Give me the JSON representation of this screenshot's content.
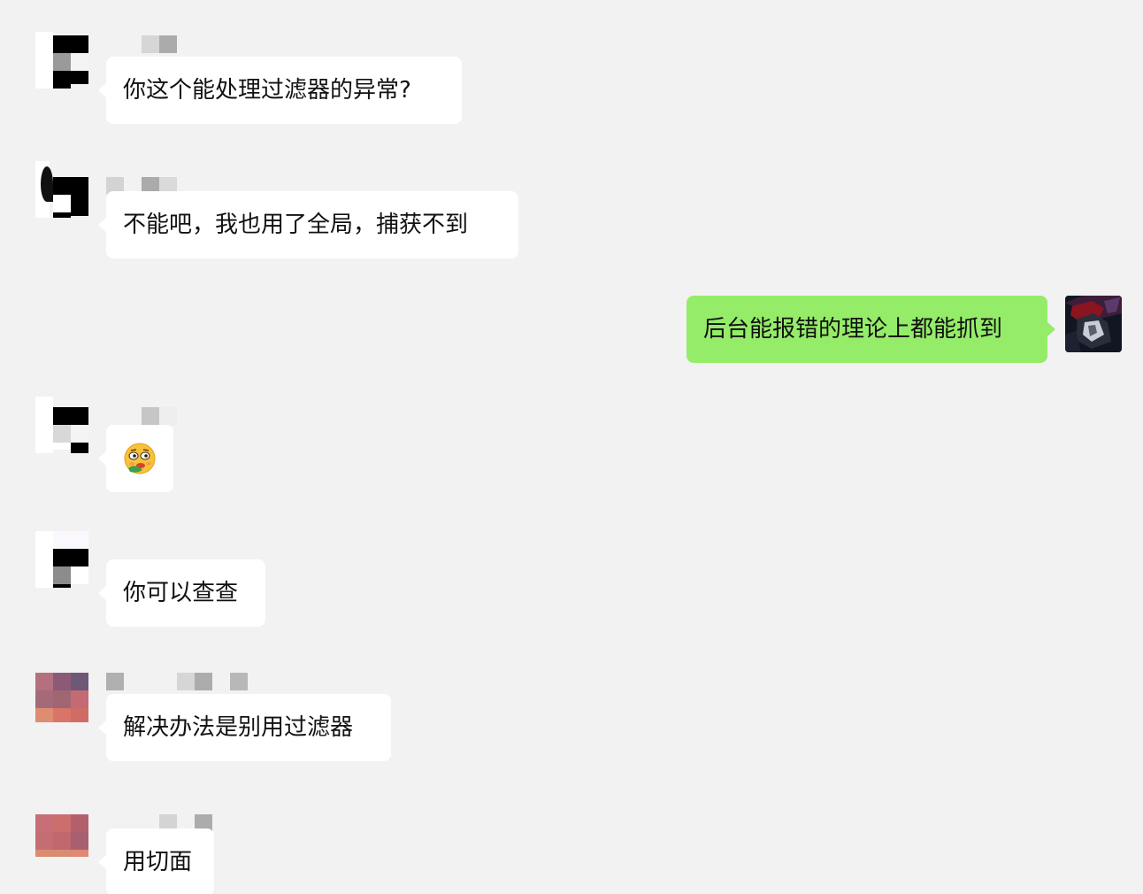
{
  "colors": {
    "background": "#f2f2f2",
    "incoming_bubble": "#ffffff",
    "outgoing_bubble": "#95ec69",
    "text": "#111111"
  },
  "messages": [
    {
      "side": "left",
      "sender_name": "",
      "text": "你这个能处理过滤器的异常?"
    },
    {
      "side": "left",
      "sender_name": "",
      "text": "不能吧，我也用了全局，捕获不到"
    },
    {
      "side": "right",
      "text": "后台能报错的理论上都能抓到"
    },
    {
      "side": "left",
      "sender_name": "",
      "text": "",
      "emoji": "thinking-face-emoji"
    },
    {
      "side": "left",
      "sender_name": "",
      "text": "你可以查查"
    },
    {
      "side": "left",
      "sender_name": "",
      "text": "解决办法是别用过滤器"
    },
    {
      "side": "left",
      "sender_name": "",
      "text": "用切面"
    }
  ]
}
